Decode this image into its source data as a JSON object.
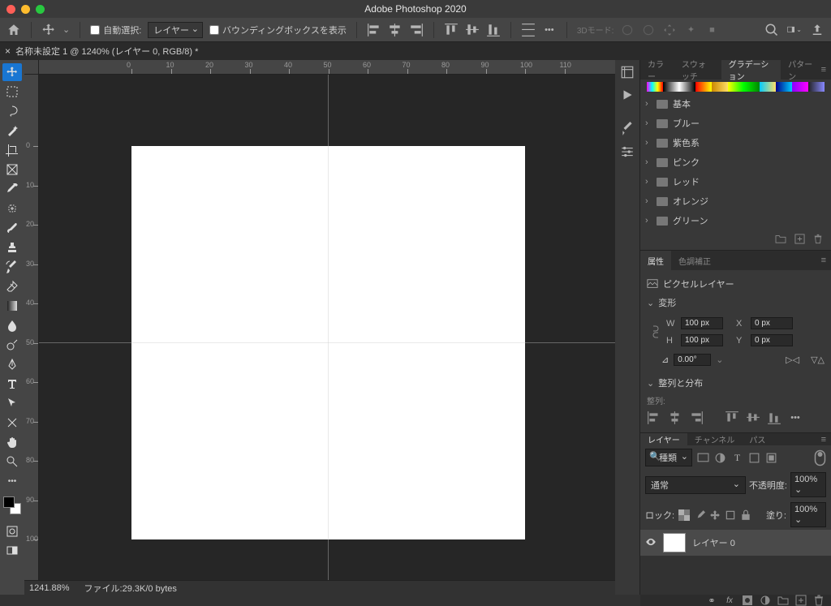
{
  "title": "Adobe Photoshop 2020",
  "optbar": {
    "auto_select": "自動選択:",
    "target": "レイヤー",
    "bounding": "バウンディングボックスを表示",
    "mode3d": "3Dモード:"
  },
  "doctab": "名称未設定 1 @ 1240% (レイヤー 0, RGB/8) *",
  "ruler_h": [
    0,
    10,
    20,
    30,
    40,
    50,
    60,
    70,
    80,
    90,
    100,
    110
  ],
  "ruler_v": [
    0,
    10,
    20,
    30,
    40,
    50,
    60,
    70,
    80,
    90,
    100
  ],
  "status": {
    "zoom": "1241.88%",
    "file": "ファイル:29.3K/0 bytes"
  },
  "panel_color": {
    "tabs": [
      "カラー",
      "スウォッチ",
      "グラデーション",
      "パターン"
    ],
    "active": 2,
    "folders": [
      "基本",
      "ブルー",
      "紫色系",
      "ピンク",
      "レッド",
      "オレンジ",
      "グリーン"
    ]
  },
  "panel_prop": {
    "tabs": [
      "属性",
      "色調補正"
    ],
    "active": 0,
    "pixel_layer": "ピクセルレイヤー",
    "transform": "変形",
    "W_lab": "W",
    "W": "100 px",
    "H_lab": "H",
    "H": "100 px",
    "X_lab": "X",
    "X": "0 px",
    "Y_lab": "Y",
    "Y": "0 px",
    "angle": "0.00°",
    "align_dist": "整列と分布",
    "align": "整列:"
  },
  "panel_layer": {
    "tabs": [
      "レイヤー",
      "チャンネル",
      "パス"
    ],
    "active": 0,
    "kind": "種類",
    "blend": "通常",
    "opacity_lab": "不透明度:",
    "opacity": "100%",
    "lock_lab": "ロック:",
    "fill_lab": "塗り:",
    "fill": "100%",
    "layer0": "レイヤー 0",
    "foot_link": "∞",
    "foot_fx": "fx"
  }
}
